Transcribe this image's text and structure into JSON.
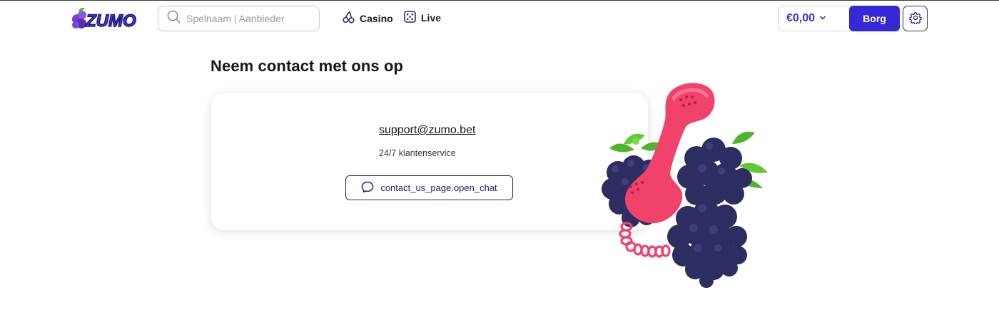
{
  "header": {
    "logo_text": "ZUMO",
    "search": {
      "placeholder": "Spelnaam | Aanbieder",
      "value": ""
    },
    "nav": [
      {
        "label": "Casino",
        "icon": "cherries-icon"
      },
      {
        "label": "Live",
        "icon": "dice-icon"
      }
    ],
    "balance": "€0,00",
    "deposit_label": "Borg",
    "settings_icon": "gear-icon"
  },
  "main": {
    "title": "Neem contact met ons op",
    "email": "support@zumo.bet",
    "service_text": "24/7 klantenservice",
    "chat_button_label": "contact_us_page.open_chat",
    "chat_icon": "chat-bubble-icon",
    "illustration": "blackberries-telephone-illustration"
  },
  "colors": {
    "accent": "#3528d6",
    "balance_text": "#3a2fd6",
    "phone": "#f0426b",
    "berry": "#2e2d62",
    "leaf": "#4fb52a"
  }
}
